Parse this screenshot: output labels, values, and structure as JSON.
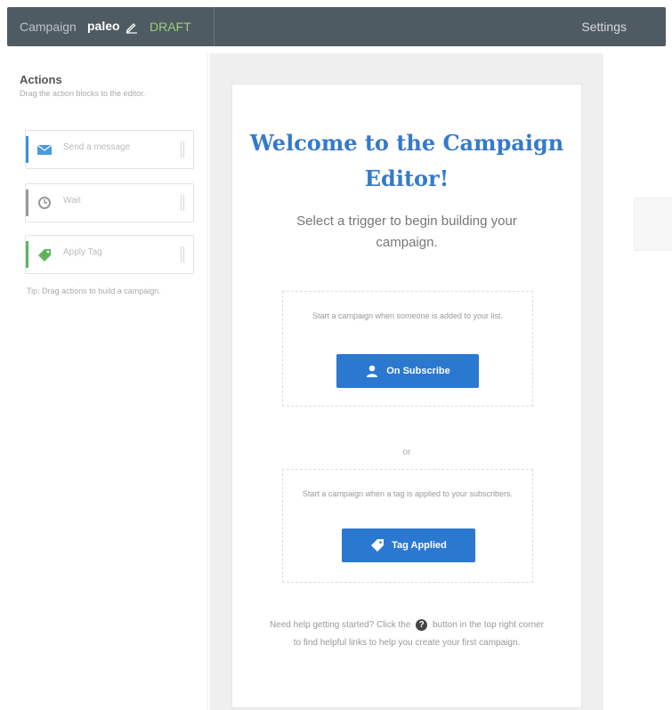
{
  "header": {
    "campaign_label": "Campaign",
    "campaign_name": "paleo",
    "status": "DRAFT",
    "settings_label": "Settings"
  },
  "sidebar": {
    "title": "Actions",
    "subtitle": "Drag the action blocks to the editor.",
    "items": [
      {
        "label": "Send a message",
        "icon": "envelope-icon",
        "color": "#3a8fd8"
      },
      {
        "label": "Wait",
        "icon": "clock-icon",
        "color": "#888888"
      },
      {
        "label": "Apply Tag",
        "icon": "tag-icon",
        "color": "#5fb35f"
      }
    ],
    "note": "Tip: Drag actions to build a campaign."
  },
  "main": {
    "welcome_title": "Welcome to the Campaign Editor!",
    "subtitle": "Select a trigger to begin building your campaign.",
    "triggers": [
      {
        "text": "Start a campaign when someone is added to your list.",
        "button_label": "On Subscribe",
        "icon": "user-icon"
      },
      {
        "text": "Start a campaign when a tag is applied to your subscribers.",
        "button_label": "Tag Applied",
        "icon": "tag-icon"
      }
    ],
    "or_label": "or",
    "help_text_before": "Need help getting started? Click the",
    "help_icon": "?",
    "help_text_after": "button in the top right corner to find helpful links to help you create your first campaign."
  },
  "colors": {
    "header_bg": "#4f5b63",
    "accent_blue": "#2a78d0",
    "title_blue": "#3579cc",
    "draft_green": "#9ccd7a",
    "canvas_bg": "#efefef"
  }
}
